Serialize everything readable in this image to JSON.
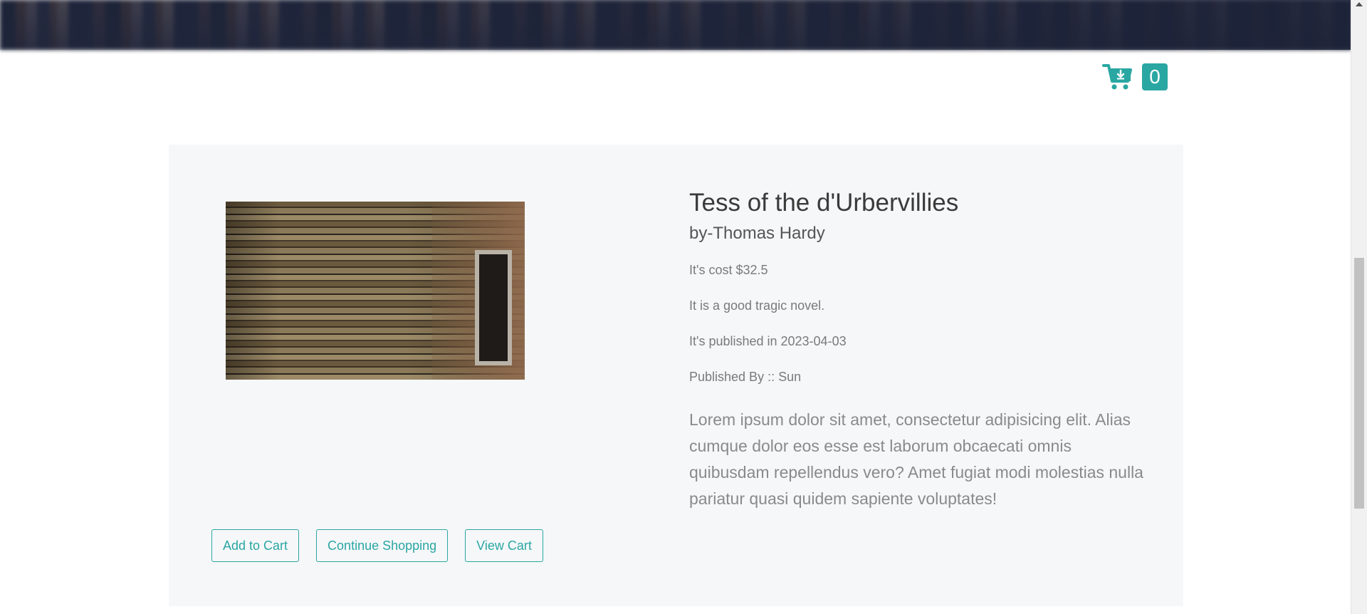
{
  "cart": {
    "icon": "shopping-cart-icon",
    "count": "0",
    "accent_color": "#2aa7a3"
  },
  "product": {
    "title": "Tess of the d'Urbervillies",
    "author": "by-Thomas Hardy",
    "price_line": "It's cost  $32.5",
    "summary": "It is a good tragic novel.",
    "published_line": "It's published in 2023-04-03",
    "publisher_line": "Published By :: Sun",
    "description": "Lorem ipsum dolor sit amet, consectetur adipisicing elit. Alias cumque dolor eos esse est laborum obcaecati omnis quibusdam repellendus vero? Amet fugiat modi molestias nulla pariatur quasi quidem sapiente voluptates!"
  },
  "actions": {
    "add_to_cart": "Add to Cart",
    "continue_shopping": "Continue Shopping",
    "view_cart": "View Cart"
  }
}
